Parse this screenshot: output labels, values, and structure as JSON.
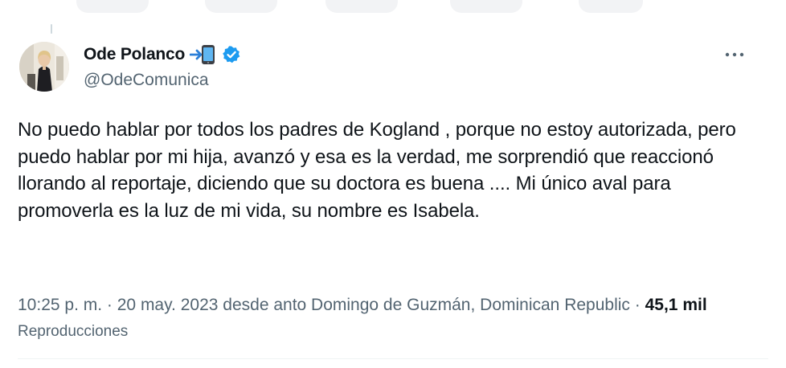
{
  "tweet": {
    "display_name": "Ode Polanco",
    "name_emoji": "📲",
    "verified": true,
    "handle": "@OdeComunica",
    "more_label": "•••",
    "text": "No puedo hablar por todos los padres de Kogland , porque no estoy autorizada, pero puedo hablar por mi hija, avanzó y esa es la verdad, me sorprendió que reaccionó llorando al reportaje, diciendo que su doctora es buena .... Mi único aval para promoverla es la luz de mi vida, su nombre es Isabela.",
    "time": "10:25 p. m.",
    "separator": "·",
    "date": "20 may. 2023",
    "location": "desde anto Domingo de Guzmán, Dominican Republic",
    "views_count": "45,1 mil",
    "views_label": "Reproducciones"
  },
  "icons": {
    "more": "more-horizontal-icon",
    "verified": "verified-badge-icon",
    "avatar": "profile-photo"
  },
  "colors": {
    "text": "#0f1419",
    "secondary": "#536471",
    "verified": "#1d9bf0",
    "divider": "#eff3f4"
  }
}
